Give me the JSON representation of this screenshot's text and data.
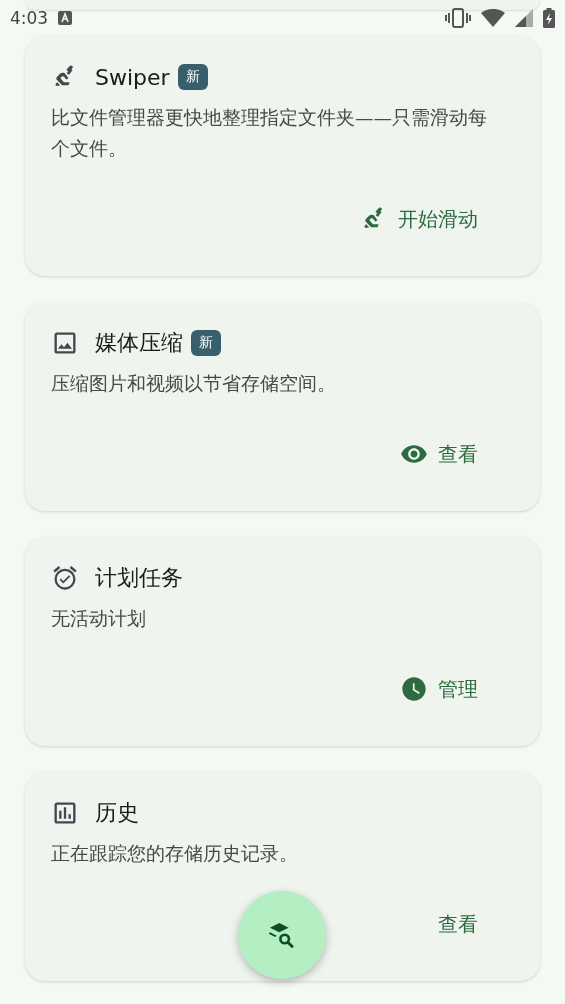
{
  "status_bar": {
    "time": "4:03"
  },
  "cards": [
    {
      "title": "Swiper",
      "badge": "新",
      "description": "比文件管理器更快地整理指定文件夹——只需滑动每个文件。",
      "action": {
        "label": "开始滑动"
      }
    },
    {
      "title": "媒体压缩",
      "badge": "新",
      "description": "压缩图片和视频以节省存储空间。",
      "action": {
        "label": "查看"
      }
    },
    {
      "title": "计划任务",
      "description": "无活动计划",
      "action": {
        "label": "管理"
      }
    },
    {
      "title": "历史",
      "description": "正在跟踪您的存储历史记录。",
      "action": {
        "label": "查看"
      }
    }
  ]
}
